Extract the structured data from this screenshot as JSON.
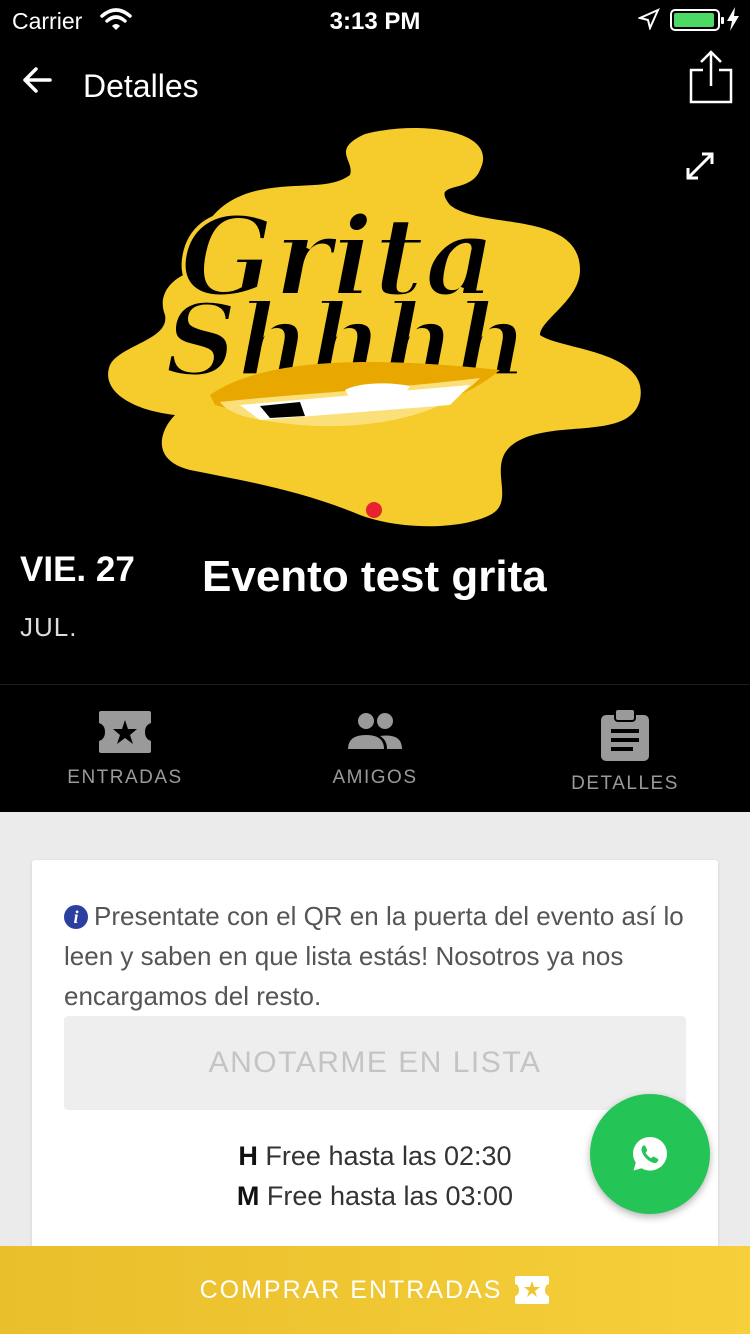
{
  "status_bar": {
    "carrier": "Carrier",
    "time": "3:13 PM"
  },
  "nav": {
    "title": "Detalles"
  },
  "hero": {
    "logo_text_line1": "Grita",
    "logo_text_line2": "Shhhh",
    "accent_color": "#f6cb2c"
  },
  "event": {
    "date": "VIE. 27",
    "month": "JUL.",
    "title": "Evento test grita"
  },
  "tabs": [
    {
      "label": "ENTRADAS",
      "icon": "ticket-icon"
    },
    {
      "label": "AMIGOS",
      "icon": "people-icon"
    },
    {
      "label": "DETALLES",
      "icon": "clipboard-icon"
    }
  ],
  "card": {
    "info_text": "Presentate con el QR en la puerta del evento así lo leen y saben en que lista estás! Nosotros ya nos encargamos del resto.",
    "button_label": "ANOTARME EN LISTA",
    "prices": [
      {
        "gender": "H",
        "text": "Free hasta las 02:30"
      },
      {
        "gender": "M",
        "text": "Free hasta las 03:00"
      }
    ]
  },
  "buy": {
    "label": "COMPRAR ENTRADAS"
  },
  "colors": {
    "whatsapp_green": "#25c456",
    "buy_bar": "#f6cf3a"
  }
}
